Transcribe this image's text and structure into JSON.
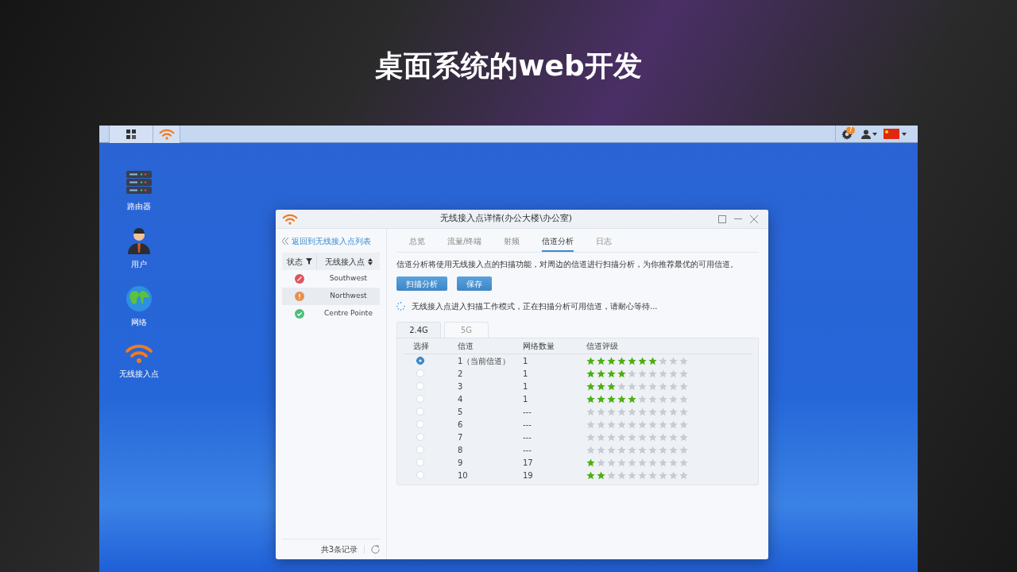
{
  "slide_title": "桌面系统的web开发",
  "taskbar": {
    "notification_count": "7"
  },
  "desktop_icons": [
    {
      "kind": "router",
      "label": "路由器"
    },
    {
      "kind": "user",
      "label": "用户"
    },
    {
      "kind": "globe",
      "label": "网络"
    },
    {
      "kind": "wifi",
      "label": "无线接入点"
    }
  ],
  "window": {
    "title": "无线接入点详情(办公大楼\\办公室)",
    "back_link": "返回到无线接入点列表",
    "ap_table": {
      "columns": [
        "状态",
        "无线接入点"
      ],
      "rows": [
        {
          "kind": "error",
          "name": "Southwest",
          "selected": false
        },
        {
          "kind": "warning",
          "name": "Northwest",
          "selected": true
        },
        {
          "kind": "ok",
          "name": "Centre Pointe",
          "selected": false
        }
      ]
    },
    "record_count": "共3条记录",
    "tabs": [
      {
        "label": "总览",
        "selected": false
      },
      {
        "label": "流量/终端",
        "selected": false
      },
      {
        "label": "射频",
        "selected": false
      },
      {
        "label": "信道分析",
        "selected": true
      },
      {
        "label": "日志",
        "selected": false
      }
    ],
    "description": "信道分析将使用无线接入点的扫描功能，对周边的信道进行扫描分析，为你推荐最优的可用信道。",
    "buttons": [
      "扫描分析",
      "保存"
    ],
    "scan_message": "无线接入点进入扫描工作模式，正在扫描分析可用信道，请耐心等待...",
    "band_tabs": [
      {
        "label": "2.4G",
        "selected": true
      },
      {
        "label": "5G",
        "selected": false
      }
    ],
    "channel_table": {
      "columns": [
        "选择",
        "信道",
        "网络数量",
        "信道评级"
      ],
      "rows": [
        {
          "selected": true,
          "channel": "1（当前信道）",
          "networks": "1",
          "stars": 7
        },
        {
          "selected": false,
          "channel": "2",
          "networks": "1",
          "stars": 4
        },
        {
          "selected": false,
          "channel": "3",
          "networks": "1",
          "stars": 3
        },
        {
          "selected": false,
          "channel": "4",
          "networks": "1",
          "stars": 5
        },
        {
          "selected": false,
          "channel": "5",
          "networks": "---",
          "stars": 0
        },
        {
          "selected": false,
          "channel": "6",
          "networks": "---",
          "stars": 0
        },
        {
          "selected": false,
          "channel": "7",
          "networks": "---",
          "stars": 0
        },
        {
          "selected": false,
          "channel": "8",
          "networks": "---",
          "stars": 0
        },
        {
          "selected": false,
          "channel": "9",
          "networks": "17",
          "stars": 1
        },
        {
          "selected": false,
          "channel": "10",
          "networks": "19",
          "stars": 2
        }
      ]
    }
  }
}
